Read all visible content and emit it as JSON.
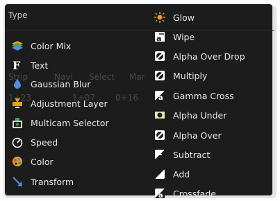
{
  "menu": {
    "title": "Type",
    "ghost_texts": [
      "Strip",
      "Navi",
      "Select",
      "Mar",
      "1+23",
      "1+07",
      "0+16"
    ],
    "column1": [
      {
        "label": "Color Mix",
        "icon": "color-mix-icon"
      },
      {
        "label": "Text",
        "icon": "text-icon"
      },
      {
        "label": "Gaussian Blur",
        "icon": "blur-drop-icon"
      },
      {
        "label": "Adjustment Layer",
        "icon": "adjustment-layer-icon"
      },
      {
        "label": "Multicam Selector",
        "icon": "multicam-icon"
      },
      {
        "label": "Speed",
        "icon": "speed-icon"
      },
      {
        "label": "Color",
        "icon": "color-palette-icon"
      },
      {
        "label": "Transform",
        "icon": "transform-arrow-icon"
      }
    ],
    "column2": [
      {
        "label": "Glow",
        "icon": "glow-sun-icon"
      },
      {
        "label": "Wipe",
        "icon": "wipe-icon"
      },
      {
        "label": "Alpha Over Drop",
        "icon": "alpha-over-drop-icon"
      },
      {
        "label": "Multiply",
        "icon": "multiply-icon"
      },
      {
        "label": "Gamma Cross",
        "icon": "gamma-cross-icon"
      },
      {
        "label": "Alpha Under",
        "icon": "alpha-under-icon"
      },
      {
        "label": "Alpha Over",
        "icon": "alpha-over-icon"
      },
      {
        "label": "Subtract",
        "icon": "subtract-icon"
      },
      {
        "label": "Add",
        "icon": "add-icon"
      },
      {
        "label": "Crossfade",
        "icon": "crossfade-icon"
      }
    ]
  }
}
